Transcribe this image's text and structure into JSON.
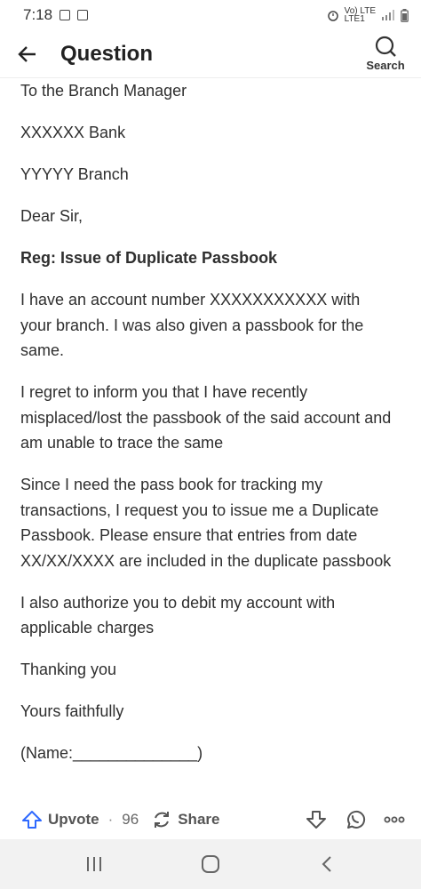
{
  "status_bar": {
    "time": "7:18",
    "network_top": "Vo) LTE",
    "network_bottom": "LTE1"
  },
  "app_bar": {
    "title": "Question",
    "search_label": "Search"
  },
  "content": {
    "paragraphs": [
      {
        "text": "To the Branch Manager",
        "bold": false
      },
      {
        "text": "XXXXXX Bank",
        "bold": false
      },
      {
        "text": "YYYYY Branch",
        "bold": false
      },
      {
        "text": "Dear Sir,",
        "bold": false
      },
      {
        "text": "Reg: Issue of Duplicate Passbook",
        "bold": true
      },
      {
        "text": "I have an account number XXXXXXXXXXX with your branch. I was also given a passbook for the same.",
        "bold": false
      },
      {
        "text": "I regret to inform you that I have recently misplaced/lost the passbook of the said account and am unable to trace the same",
        "bold": false
      },
      {
        "text": "Since I need the pass book for tracking my transactions, I request you to issue me a Duplicate Passbook. Please ensure that entries from date XX/XX/XXXX are included in the duplicate passbook",
        "bold": false
      },
      {
        "text": "I also authorize you to debit my account with applicable charges",
        "bold": false
      },
      {
        "text": "Thanking you",
        "bold": false
      },
      {
        "text": "Yours faithfully",
        "bold": false
      },
      {
        "text": "(Name:______________)",
        "bold": false
      }
    ]
  },
  "actions": {
    "upvote_label": "Upvote",
    "separator": "·",
    "upvote_count": "96",
    "share_label": "Share"
  },
  "icons": {
    "back": "arrow-left-icon",
    "search": "search-icon",
    "upvote": "upvote-arrow-icon",
    "share": "share-icon",
    "downvote": "downvote-arrow-icon",
    "whatsapp": "whatsapp-icon",
    "more": "more-dots-icon"
  },
  "colors": {
    "upvote_accent": "#2e69ff",
    "text": "#2f2f2f",
    "nav_bg": "#f2f2f2"
  }
}
